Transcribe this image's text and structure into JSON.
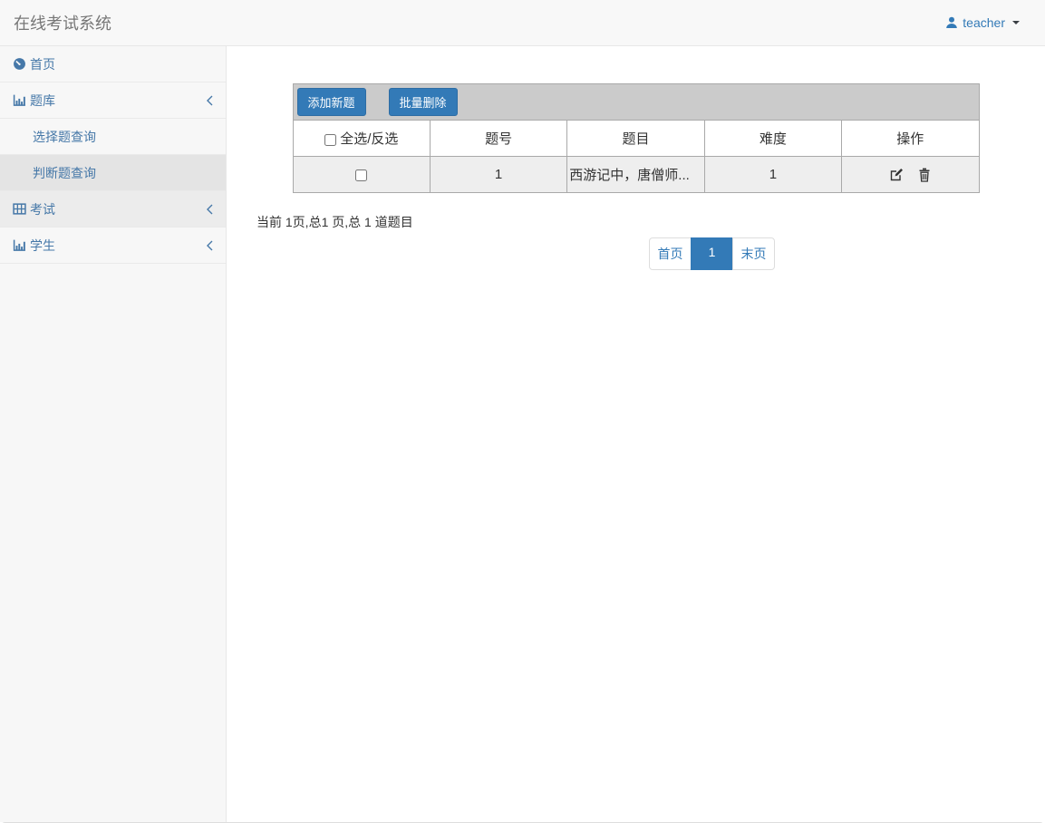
{
  "app": {
    "title": "在线考试系统"
  },
  "header": {
    "user_name": "teacher",
    "user_icon": "user-icon",
    "caret_icon": "caret-down-icon"
  },
  "sidebar": {
    "items": [
      {
        "label": "首页",
        "icon": "dashboard-icon"
      },
      {
        "label": "题库",
        "icon": "bar-chart-icon",
        "chevron": "chevron-left-icon"
      },
      {
        "label": "选择题查询"
      },
      {
        "label": "判断题查询",
        "state": "active"
      },
      {
        "label": "考试",
        "icon": "table-grid-icon",
        "chevron": "chevron-left-icon"
      },
      {
        "label": "学生",
        "icon": "bar-chart-icon",
        "chevron": "chevron-left-icon"
      }
    ]
  },
  "toolbar": {
    "add_question_label": "添加新题",
    "batch_delete_label": "批量删除"
  },
  "table": {
    "headers": {
      "select": "全选/反选",
      "id": "题号",
      "title": "题目",
      "difficulty": "难度",
      "actions": "操作"
    },
    "rows": [
      {
        "id": "1",
        "title": "西游记中，唐僧师...",
        "difficulty": "1",
        "action_icons": [
          "edit-icon",
          "trash-icon"
        ]
      }
    ]
  },
  "pagination": {
    "summary": "当前 1页,总1 页,总 1 道题目",
    "first_label": "首页",
    "current_page": "1",
    "last_label": "末页"
  },
  "colors": {
    "primary_blue": "#337ab7",
    "sidebar_link": "#4678a8",
    "toolbar_bg": "#cbcbcb",
    "row_stripe": "#eeeeee",
    "navbar_bg": "#f8f8f8"
  }
}
